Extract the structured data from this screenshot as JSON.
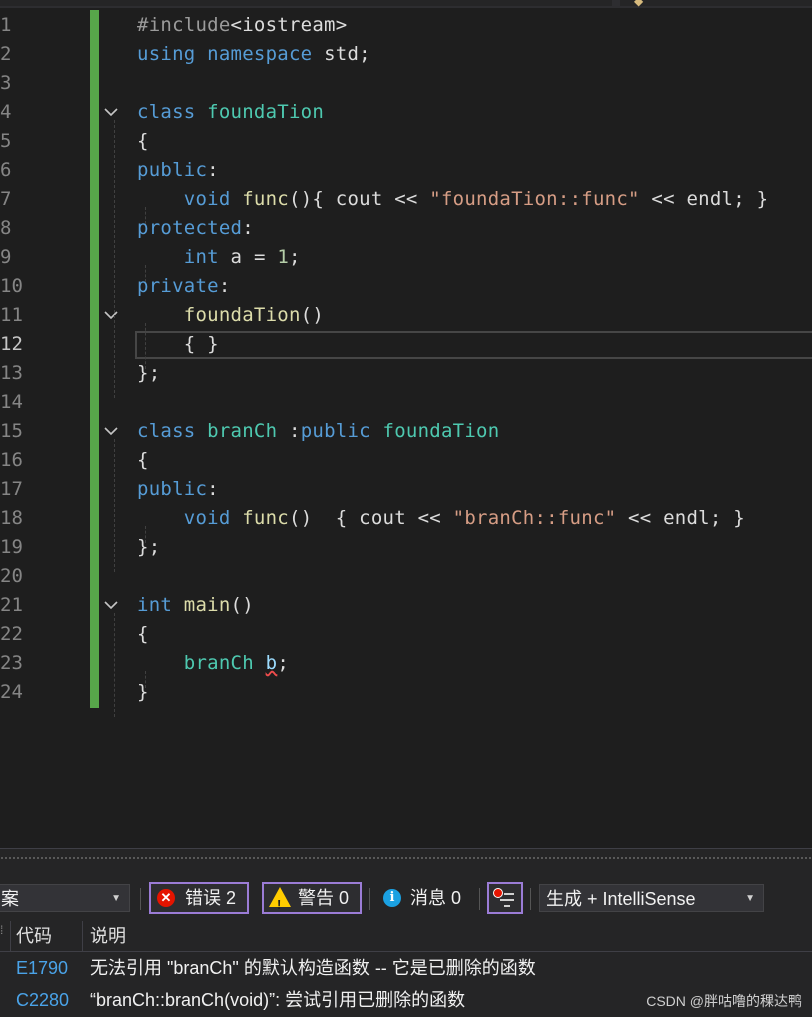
{
  "editor": {
    "current_line": 12,
    "lines": [
      {
        "n": "1",
        "tokens": [
          {
            "t": "#include",
            "c": "pp"
          },
          {
            "t": "<iostream>",
            "c": "inc"
          }
        ]
      },
      {
        "n": "2",
        "tokens": [
          {
            "t": "using",
            "c": "kw"
          },
          {
            "t": " "
          },
          {
            "t": "namespace",
            "c": "kw"
          },
          {
            "t": " "
          },
          {
            "t": "std",
            "c": "pl"
          },
          {
            "t": ";"
          }
        ]
      },
      {
        "n": "3",
        "tokens": []
      },
      {
        "n": "4",
        "fold": true,
        "tokens": [
          {
            "t": "class",
            "c": "kw"
          },
          {
            "t": " "
          },
          {
            "t": "foundaTion",
            "c": "ty"
          }
        ]
      },
      {
        "n": "5",
        "tokens": [
          {
            "t": "{"
          }
        ]
      },
      {
        "n": "6",
        "tokens": [
          {
            "t": "public",
            "c": "kw"
          },
          {
            "t": ":"
          }
        ]
      },
      {
        "n": "7",
        "tokens": [
          {
            "t": "    "
          },
          {
            "t": "void",
            "c": "kw"
          },
          {
            "t": " "
          },
          {
            "t": "func",
            "c": "fn"
          },
          {
            "t": "(){ "
          },
          {
            "t": "cout",
            "c": "pl"
          },
          {
            "t": " << "
          },
          {
            "t": "\"foundaTion::func\"",
            "c": "st"
          },
          {
            "t": " << "
          },
          {
            "t": "endl",
            "c": "pl"
          },
          {
            "t": "; }"
          }
        ]
      },
      {
        "n": "8",
        "tokens": [
          {
            "t": "protected",
            "c": "kw"
          },
          {
            "t": ":"
          }
        ]
      },
      {
        "n": "9",
        "tokens": [
          {
            "t": "    "
          },
          {
            "t": "int",
            "c": "kw"
          },
          {
            "t": " "
          },
          {
            "t": "a",
            "c": "pl"
          },
          {
            "t": " = "
          },
          {
            "t": "1",
            "c": "nu"
          },
          {
            "t": ";"
          }
        ]
      },
      {
        "n": "10",
        "tokens": [
          {
            "t": "private",
            "c": "kw"
          },
          {
            "t": ":"
          }
        ]
      },
      {
        "n": "11",
        "fold": true,
        "tokens": [
          {
            "t": "    "
          },
          {
            "t": "foundaTion",
            "c": "fn"
          },
          {
            "t": "()"
          }
        ]
      },
      {
        "n": "12",
        "tokens": [
          {
            "t": "    "
          },
          {
            "t": "{ }"
          }
        ]
      },
      {
        "n": "13",
        "tokens": [
          {
            "t": "};"
          }
        ]
      },
      {
        "n": "14",
        "tokens": []
      },
      {
        "n": "15",
        "fold": true,
        "tokens": [
          {
            "t": "class",
            "c": "kw"
          },
          {
            "t": " "
          },
          {
            "t": "branCh",
            "c": "ty"
          },
          {
            "t": " :"
          },
          {
            "t": "public",
            "c": "kw"
          },
          {
            "t": " "
          },
          {
            "t": "foundaTion",
            "c": "ty"
          }
        ]
      },
      {
        "n": "16",
        "tokens": [
          {
            "t": "{"
          }
        ]
      },
      {
        "n": "17",
        "tokens": [
          {
            "t": "public",
            "c": "kw"
          },
          {
            "t": ":"
          }
        ]
      },
      {
        "n": "18",
        "tokens": [
          {
            "t": "    "
          },
          {
            "t": "void",
            "c": "kw"
          },
          {
            "t": " "
          },
          {
            "t": "func",
            "c": "fn"
          },
          {
            "t": "()  { "
          },
          {
            "t": "cout",
            "c": "pl"
          },
          {
            "t": " << "
          },
          {
            "t": "\"branCh::func\"",
            "c": "st"
          },
          {
            "t": " << "
          },
          {
            "t": "endl",
            "c": "pl"
          },
          {
            "t": "; }"
          }
        ]
      },
      {
        "n": "19",
        "tokens": [
          {
            "t": "};"
          }
        ]
      },
      {
        "n": "20",
        "tokens": []
      },
      {
        "n": "21",
        "fold": true,
        "tokens": [
          {
            "t": "int",
            "c": "kw"
          },
          {
            "t": " "
          },
          {
            "t": "main",
            "c": "fn"
          },
          {
            "t": "()"
          }
        ]
      },
      {
        "n": "22",
        "tokens": [
          {
            "t": "{"
          }
        ]
      },
      {
        "n": "23",
        "tokens": [
          {
            "t": "    "
          },
          {
            "t": "branCh",
            "c": "ty"
          },
          {
            "t": " "
          },
          {
            "t": "b",
            "c": "va",
            "squig": true
          },
          {
            "t": ";"
          }
        ]
      },
      {
        "n": "24",
        "tokens": [
          {
            "t": "}"
          }
        ]
      }
    ]
  },
  "error_list": {
    "scope_dropdown": "案",
    "errors_label": "错误 2",
    "warnings_label": "警告 0",
    "messages_label": "消息 0",
    "build_dropdown": "生成 + IntelliSense",
    "col_code": "代码",
    "col_desc": "说明",
    "rows": [
      {
        "code": "E1790",
        "desc": "无法引用 \"branCh\" 的默认构造函数 -- 它是已删除的函数"
      },
      {
        "code": "C2280",
        "desc": "“branCh::branCh(void)”: 尝试引用已删除的函数"
      }
    ]
  },
  "watermark": "CSDN @胖咕噜的稞达鸭",
  "colors": {
    "keyword": "#569cd6",
    "type": "#4ec9b0",
    "function": "#dcdcaa",
    "string": "#d69d85",
    "change_bar": "#57a64a"
  }
}
